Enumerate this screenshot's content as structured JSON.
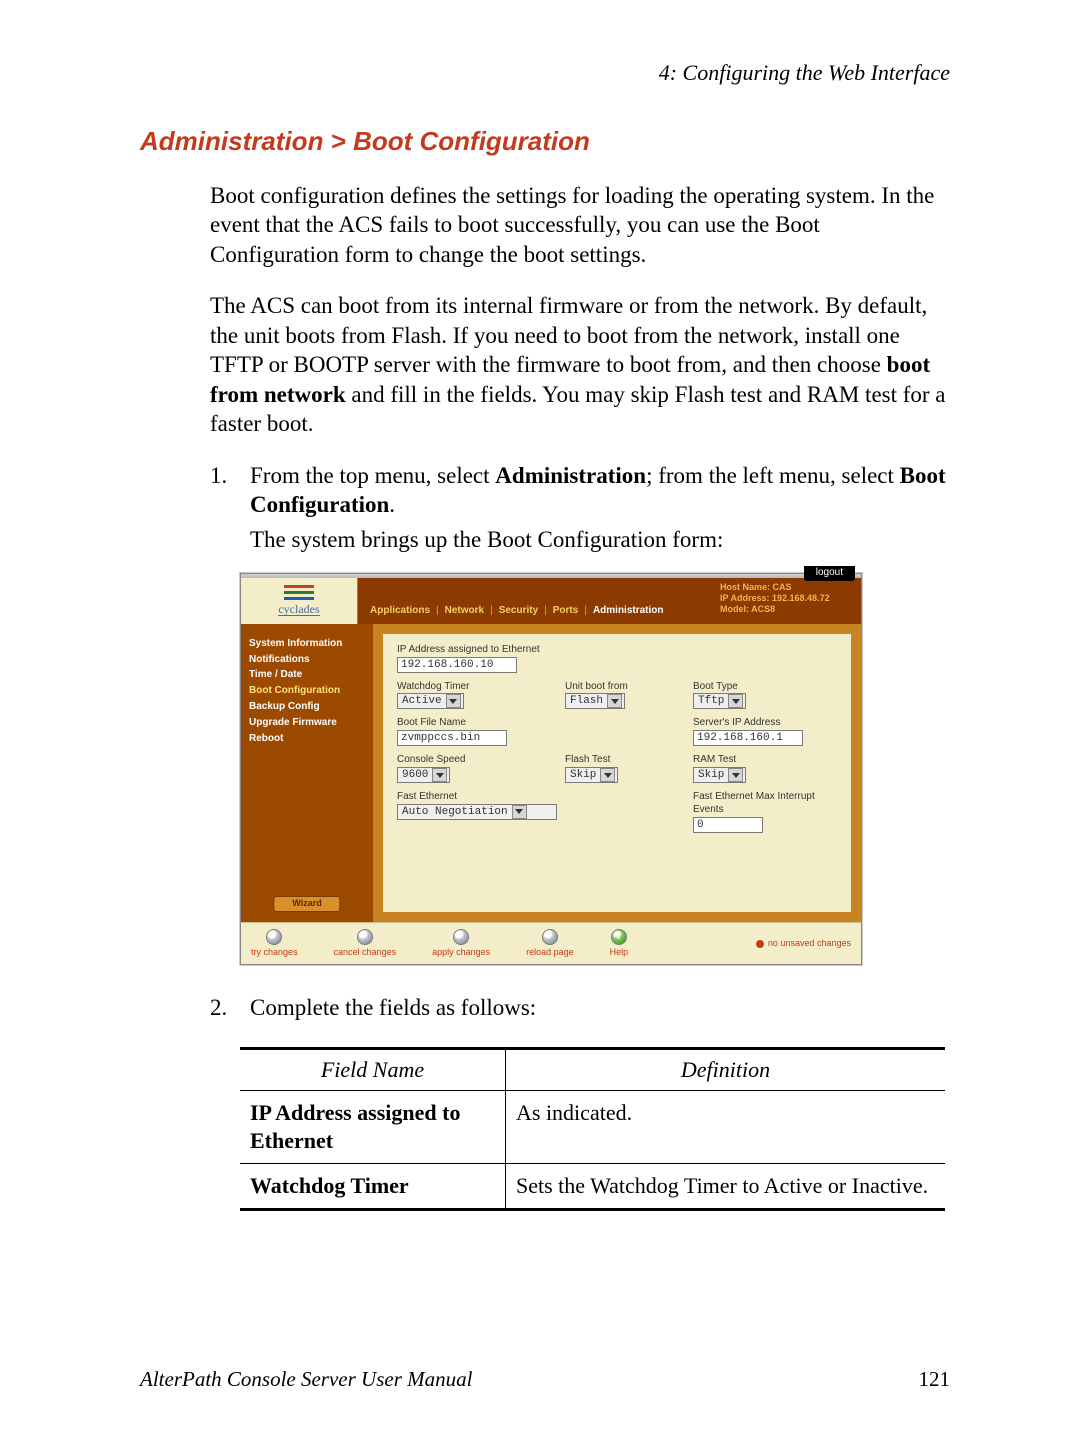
{
  "running_head": "4: Configuring the Web Interface",
  "section_title": "Administration > Boot Configuration",
  "para1": "Boot configuration defines the settings for loading the operating system. In the event that the ACS fails to boot successfully, you can use the Boot Configuration form to change the boot settings.",
  "para2a": "The ACS can boot from its internal firmware or from the network. By default, the unit boots from Flash. If you need to boot from the network, install one TFTP or BOOTP server with the firmware to boot from, and then choose ",
  "para2b_bold": "boot from network",
  "para2c": " and fill in the fields. You may skip Flash test and RAM test for a faster boot.",
  "step1_num": "1.",
  "step1_a": "From the top menu, select ",
  "step1_b_bold": "Administration",
  "step1_c": "; from the left menu, select ",
  "step1_d_bold": "Boot Configuration",
  "step1_e": ".",
  "step1_result": "The system brings up the Boot Configuration form:",
  "step2_num": "2.",
  "step2_text": "Complete the fields as follows:",
  "table": {
    "h1": "Field Name",
    "h2": "Definition",
    "r1c1": "IP Address assigned to Ethernet",
    "r1c2": "As indicated.",
    "r2c1": "Watchdog Timer",
    "r2c2": "Sets the Watchdog Timer to Active or Inactive."
  },
  "footer_manual": "AlterPath Console Server User Manual",
  "footer_page": "121",
  "ui": {
    "brand": "cyclades",
    "logout": "logout",
    "topmenu": {
      "applications": "Applications",
      "network": "Network",
      "security": "Security",
      "ports": "Ports",
      "administration": "Administration"
    },
    "hostinfo": {
      "host": "Host Name: CAS",
      "ip": "IP Address: 192.168.48.72",
      "model": "Model: ACS8"
    },
    "side": {
      "sysinfo": "System Information",
      "notifications": "Notifications",
      "timedate": "Time / Date",
      "bootconfig": "Boot Configuration",
      "backup": "Backup Config",
      "upgrade": "Upgrade Firmware",
      "reboot": "Reboot",
      "wizard": "Wizard"
    },
    "form": {
      "ip_label": "IP Address assigned to Ethernet",
      "ip_value": "192.168.160.10",
      "watchdog_label": "Watchdog Timer",
      "watchdog_value": "Active",
      "unitboot_label": "Unit boot from",
      "unitboot_value": "Flash",
      "boottype_label": "Boot Type",
      "boottype_value": "Tftp",
      "bootfile_label": "Boot File Name",
      "bootfile_value": "zvmppccs.bin",
      "serverip_label": "Server's IP Address",
      "serverip_value": "192.168.160.1",
      "conspeed_label": "Console Speed",
      "conspeed_value": "9600",
      "flashtest_label": "Flash Test",
      "flashtest_value": "Skip",
      "ramtest_label": "RAM Test",
      "ramtest_value": "Skip",
      "fasteth_label": "Fast Ethernet",
      "fasteth_value": "Auto Negotiation",
      "maxint_label": "Fast Ethernet Max Interrupt Events",
      "maxint_value": "0"
    },
    "footerbtns": {
      "try": "try changes",
      "cancel": "cancel changes",
      "apply": "apply changes",
      "reload": "reload page",
      "help": "Help",
      "unsaved": "no unsaved changes"
    }
  }
}
